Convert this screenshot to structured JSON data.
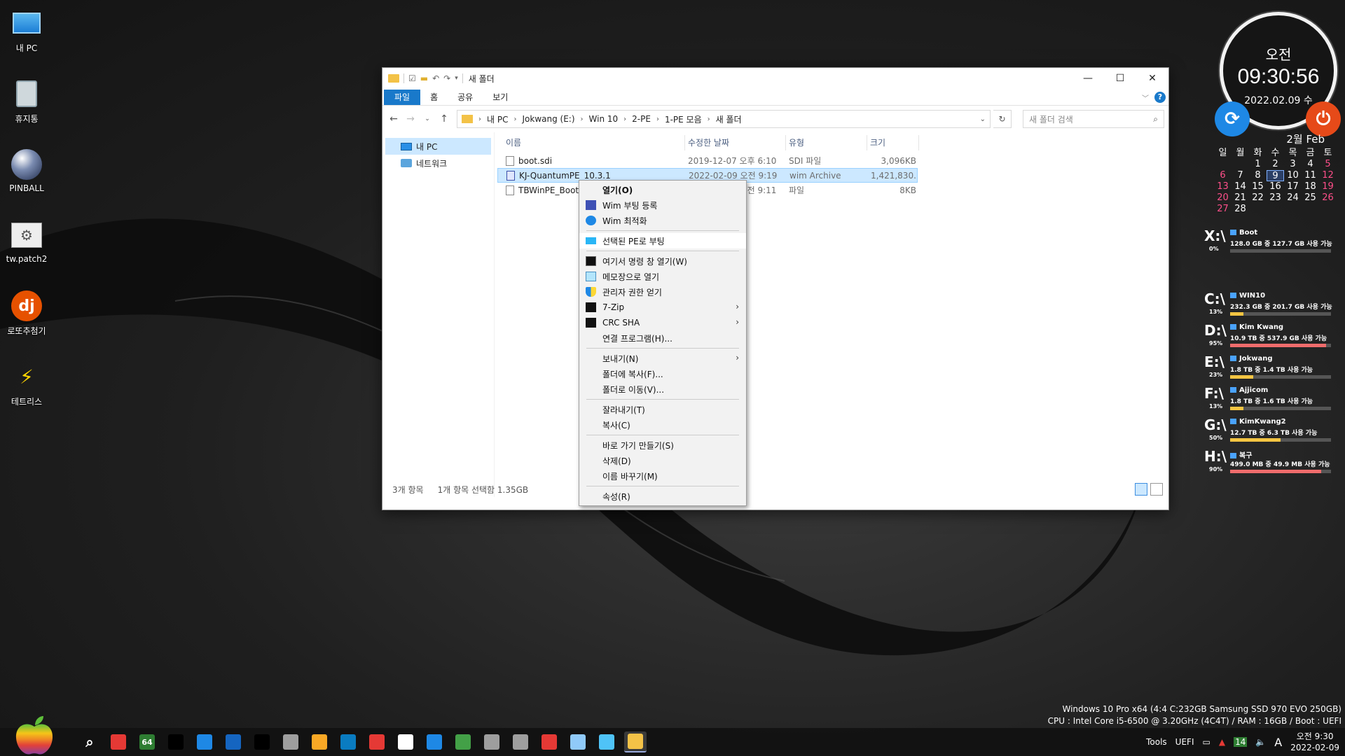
{
  "desktop": {
    "icons": [
      {
        "label": "내 PC",
        "icon": "monitor-icon"
      },
      {
        "label": "휴지통",
        "icon": "recycle-bin-icon"
      },
      {
        "label": "PINBALL",
        "icon": "pinball-icon"
      },
      {
        "label": "tw.patch2",
        "icon": "gear-icon"
      },
      {
        "label": "로또추첨기",
        "icon": "lotto-icon"
      },
      {
        "label": "테트리스",
        "icon": "tetris-icon"
      }
    ]
  },
  "clock": {
    "ampm": "오전",
    "time": "09:30:56",
    "date": "2022.02.09 수"
  },
  "calendar": {
    "header": "2월 Feb",
    "weekdays": [
      "일",
      "월",
      "화",
      "수",
      "목",
      "금",
      "토"
    ],
    "weeks": [
      [
        "",
        "",
        "1",
        "2",
        "3",
        "4",
        "5"
      ],
      [
        "6",
        "7",
        "8",
        "9",
        "10",
        "11",
        "12"
      ],
      [
        "13",
        "14",
        "15",
        "16",
        "17",
        "18",
        "19"
      ],
      [
        "20",
        "21",
        "22",
        "23",
        "24",
        "25",
        "26"
      ],
      [
        "27",
        "28",
        "",
        "",
        "",
        "",
        ""
      ]
    ],
    "today": "9"
  },
  "drives": [
    {
      "letter": "X:\\",
      "pct": "0%",
      "name": "Boot",
      "info": "128.0 GB 중  127.7 GB 사용 가능",
      "used": 0.0,
      "color": "#f4c542"
    },
    {
      "letter": "C:\\",
      "pct": "13%",
      "name": "WIN10",
      "info": "232.3 GB 중  201.7 GB 사용 가능",
      "used": 0.13,
      "color": "#f4c542"
    },
    {
      "letter": "D:\\",
      "pct": "95%",
      "name": "Kim Kwang",
      "info": "10.9 TB 중    537.9 GB 사용 가능",
      "used": 0.95,
      "color": "#ef6c6c"
    },
    {
      "letter": "E:\\",
      "pct": "23%",
      "name": "Jokwang",
      "info": "1.8 TB 중      1.4 TB 사용 가능",
      "used": 0.23,
      "color": "#f4c542"
    },
    {
      "letter": "F:\\",
      "pct": "13%",
      "name": "Ajjicom",
      "info": "1.8 TB 중      1.6 TB 사용 가능",
      "used": 0.13,
      "color": "#f4c542"
    },
    {
      "letter": "G:\\",
      "pct": "50%",
      "name": "KimKwang2",
      "info": "12.7 TB 중    6.3 TB 사용 가능",
      "used": 0.5,
      "color": "#f4c542"
    },
    {
      "letter": "H:\\",
      "pct": "90%",
      "name": "복구",
      "info": "499.0 MB 중 49.9 MB 사용 가능",
      "used": 0.9,
      "color": "#ef6c6c"
    }
  ],
  "explorer": {
    "title": "새 폴더",
    "ribbon_tabs": [
      "파일",
      "홈",
      "공유",
      "보기"
    ],
    "address": [
      "내 PC",
      "Jokwang (E:)",
      "Win 10",
      "2-PE",
      "1-PE 모음",
      "새 폴더"
    ],
    "search_placeholder": "새 폴더 검색",
    "nav": [
      {
        "label": "내 PC"
      },
      {
        "label": "네트워크"
      }
    ],
    "columns": [
      "이름",
      "수정한 날짜",
      "유형",
      "크기"
    ],
    "files": [
      {
        "name": "boot.sdi",
        "date": "2019-12-07 오후 6:10",
        "type": "SDI 파일",
        "size": "3,096KB",
        "selected": false,
        "icon": "file-icon"
      },
      {
        "name": "KJ-QuantumPE_10.3.1",
        "date": "2022-02-09 오전 9:19",
        "type": "wim Archive",
        "size": "1,421,830...",
        "selected": true,
        "icon": "wim-file-icon"
      },
      {
        "name": "TBWinPE_BootWim",
        "date": "2022-02-09 오전 9:11",
        "type": "파일",
        "size": "8KB",
        "selected": false,
        "icon": "file-icon"
      }
    ],
    "status_count": "3개 항목",
    "status_selected": "1개 항목 선택함 1.35GB"
  },
  "context_menu": [
    {
      "label": "열기(O)",
      "bold": true,
      "icon": ""
    },
    {
      "label": "Wim 부팅 등록",
      "icon": "wim-boot-icon"
    },
    {
      "label": "Wim 최적화",
      "icon": "wim-optimize-icon"
    },
    {
      "sep": true
    },
    {
      "label": "선택된 PE로 부팅",
      "icon": "pe-boot-icon",
      "hl": true
    },
    {
      "sep": true
    },
    {
      "label": "여기서 명령 창 열기(W)",
      "icon": "cmd-icon"
    },
    {
      "label": "메모장으로 열기",
      "icon": "notepad-icon"
    },
    {
      "label": "관리자 권한 얻기",
      "icon": "shield-icon"
    },
    {
      "label": "7-Zip",
      "icon": "7zip-icon",
      "sub": true
    },
    {
      "label": "CRC SHA",
      "icon": "crc-icon",
      "sub": true
    },
    {
      "label": "연결 프로그램(H)...",
      "icon": ""
    },
    {
      "sep": true
    },
    {
      "label": "보내기(N)",
      "icon": "",
      "sub": true
    },
    {
      "label": "폴더에 복사(F)...",
      "icon": ""
    },
    {
      "label": "폴더로 이동(V)...",
      "icon": ""
    },
    {
      "sep": true
    },
    {
      "label": "잘라내기(T)",
      "icon": ""
    },
    {
      "label": "복사(C)",
      "icon": ""
    },
    {
      "sep": true
    },
    {
      "label": "바로 가기 만들기(S)",
      "icon": ""
    },
    {
      "label": "삭제(D)",
      "icon": ""
    },
    {
      "label": "이름 바꾸기(M)",
      "icon": ""
    },
    {
      "sep": true
    },
    {
      "label": "속성(R)",
      "icon": ""
    }
  ],
  "sysinfo": {
    "line1": "Windows 10 Pro x64 (4:4 C:232GB Samsung SSD 970 EVO 250GB)",
    "line2": "CPU : Intel Core i5-6500 @ 3.20GHz (4C4T) / RAM : 16GB / Boot : UEFI"
  },
  "taskbar": {
    "apps": [
      {
        "icon": "search-icon",
        "color": "#000000",
        "text": ""
      },
      {
        "icon": "anydesk-icon",
        "color": "#e53935",
        "text": ""
      },
      {
        "icon": "cpu-64-icon",
        "color": "#2e7d32",
        "text": "64"
      },
      {
        "icon": "sheet-icon",
        "color": "#000000",
        "text": ""
      },
      {
        "icon": "monitor-icon",
        "color": "#1e88e5",
        "text": ""
      },
      {
        "icon": "photo-icon",
        "color": "#1565c0",
        "text": ""
      },
      {
        "icon": "drop-icon",
        "color": "#000000",
        "text": ""
      },
      {
        "icon": "calculator-icon",
        "color": "#9e9e9e",
        "text": ""
      },
      {
        "icon": "triangle-icon",
        "color": "#f9a825",
        "text": ""
      },
      {
        "icon": "edge-icon",
        "color": "#0a7cc1",
        "text": ""
      },
      {
        "icon": "chrome-icon",
        "color": "#e53935",
        "text": ""
      },
      {
        "icon": "disk-tool-icon",
        "color": "#ffffff",
        "text": ""
      },
      {
        "icon": "network-icon",
        "color": "#1e88e5",
        "text": ""
      },
      {
        "icon": "grid-icon",
        "color": "#43a047",
        "text": ""
      },
      {
        "icon": "printer-icon",
        "color": "#9e9e9e",
        "text": ""
      },
      {
        "icon": "tools-icon",
        "color": "#9e9e9e",
        "text": ""
      },
      {
        "icon": "color-icon",
        "color": "#e53935",
        "text": ""
      },
      {
        "icon": "store-icon",
        "color": "#90caf9",
        "text": ""
      },
      {
        "icon": "bird-icon",
        "color": "#4fc3f7",
        "text": ""
      },
      {
        "icon": "folder-icon",
        "color": "#f3c247",
        "text": "",
        "active": true
      }
    ],
    "tray_tools": "Tools",
    "tray_uefi": "UEFI",
    "tray_time": "오전 9:30",
    "tray_date": "2022-02-09",
    "tray_lang": "A"
  }
}
